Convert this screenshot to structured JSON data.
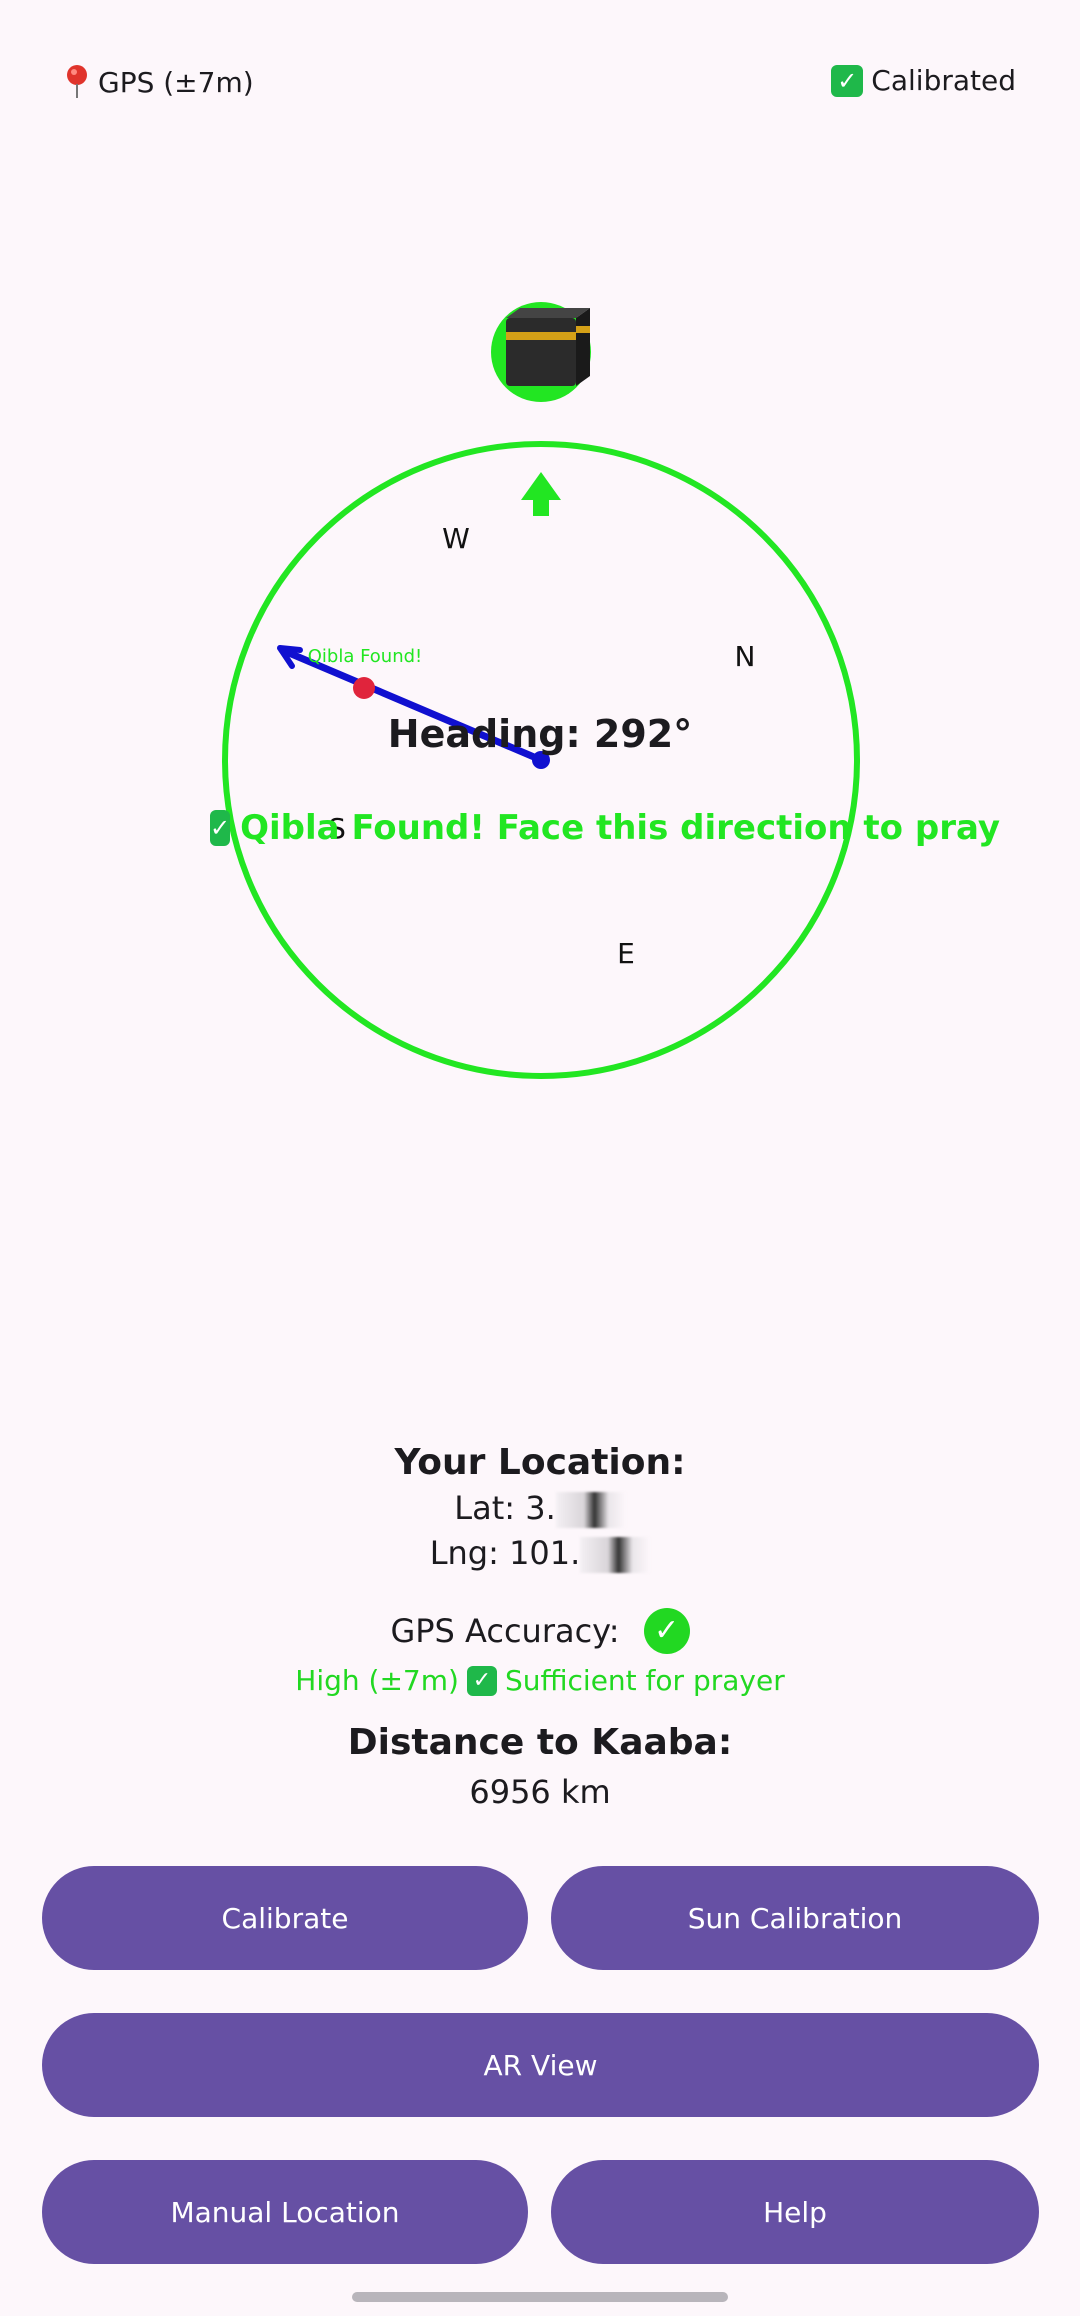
{
  "status_bar": {
    "gps_label": "GPS (±7m)",
    "calibrated_label": "Calibrated"
  },
  "compass": {
    "heading_label": "Heading: 292°",
    "directions": {
      "north": "N",
      "east": "E",
      "south": "S",
      "west": "W"
    },
    "qibla_marker_label": "Qibla Found!",
    "qibla_message": "Qibla Found! Face this direction to pray",
    "kaaba_icon": "kaaba-icon",
    "accent_color": "#22e622",
    "needle_color": "#1010d0"
  },
  "location": {
    "title": "Your Location:",
    "lat": "Lat: 3.",
    "lng": "Lng: 101."
  },
  "gps_accuracy": {
    "title": "GPS Accuracy:",
    "detail": "High (±7m)",
    "sufficient": "Sufficient for prayer"
  },
  "distance": {
    "title": "Distance to Kaaba:",
    "value": "6956 km"
  },
  "buttons": {
    "calibrate": "Calibrate",
    "sun_calibration": "Sun Calibration",
    "ar_view": "AR View",
    "manual_location": "Manual Location",
    "help": "Help"
  },
  "colors": {
    "button_bg": "#6650a4",
    "background": "#fdf7fb",
    "success_green": "#22d822"
  }
}
